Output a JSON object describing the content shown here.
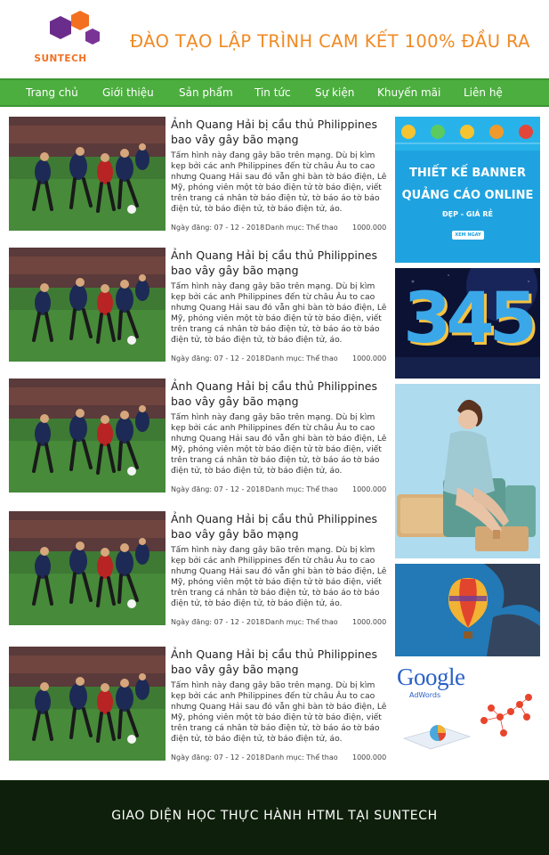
{
  "header": {
    "logo_text": "SUNTECH",
    "slogan": "ĐÀO TẠO LẬP TRÌNH CAM KẾT 100% ĐẦU RA",
    "colors": {
      "logo_purple": "#6b2d8b",
      "logo_orange": "#f37021",
      "slogan": "#f08a24"
    }
  },
  "nav": {
    "color": "#4cae3f",
    "items": [
      {
        "label": "Trang chủ"
      },
      {
        "label": "Giới thiệu"
      },
      {
        "label": "Sản phẩm"
      },
      {
        "label": "Tin tức"
      },
      {
        "label": "Sự kiện"
      },
      {
        "label": "Khuyến mãi"
      },
      {
        "label": "Liên hệ"
      }
    ]
  },
  "articles": [
    {
      "title": "Ảnh Quang Hải bị cầu thủ Philippines bao vây gây bão mạng",
      "excerpt": "Tấm hình này đang gây bão trên mạng. Dù bị kìm kẹp bởi các anh Philippines đến từ châu Âu to cao nhưng Quang Hải sau đó vẫn ghi bàn tờ báo điện, Lê Mỹ, phóng viên một tờ báo điện tử tờ báo điện, viết trên trang cá nhân tờ báo điện tử, tờ báo áo tờ báo điện tử, tờ báo điện tử, tờ báo điện tử, áo.",
      "date": "Ngày đăng: 07 - 12 - 2018",
      "category": "Danh mục: Thể thao",
      "views": "1000.000"
    },
    {
      "title": "Ảnh Quang Hải bị cầu thủ Philippines bao vây gây bão mạng",
      "excerpt": "Tấm hình này đang gây bão trên mạng. Dù bị kìm kẹp bởi các anh Philippines đến từ châu Âu to cao nhưng Quang Hải sau đó vẫn ghi bàn tờ báo điện, Lê Mỹ, phóng viên một tờ báo điện tử tờ báo điện, viết trên trang cá nhân tờ báo điện tử, tờ báo áo tờ báo điện tử, tờ báo điện tử, tờ báo điện tử, áo.",
      "date": "Ngày đăng: 07 - 12 - 2018",
      "category": "Danh mục: Thể thao",
      "views": "1000.000"
    },
    {
      "title": "Ảnh Quang Hải bị cầu thủ Philippines bao vây gây bão mạng",
      "excerpt": "Tấm hình này đang gây bão trên mạng. Dù bị kìm kẹp bởi các anh Philippines đến từ châu Âu to cao nhưng Quang Hải sau đó vẫn ghi bàn tờ báo điện, Lê Mỹ, phóng viên một tờ báo điện tử tờ báo điện, viết trên trang cá nhân tờ báo điện tử, tờ báo áo tờ báo điện tử, tờ báo điện tử, tờ báo điện tử, áo.",
      "date": "Ngày đăng: 07 - 12 - 2018",
      "category": "Danh mục: Thể thao",
      "views": "1000.000"
    },
    {
      "title": "Ảnh Quang Hải bị cầu thủ Philippines bao vây gây bão mạng",
      "excerpt": "Tấm hình này đang gây bão trên mạng. Dù bị kìm kẹp bởi các anh Philippines đến từ châu Âu to cao nhưng Quang Hải sau đó vẫn ghi bàn tờ báo điện, Lê Mỹ, phóng viên một tờ báo điện tử tờ báo điện, viết trên trang cá nhân tờ báo điện tử, tờ báo áo tờ báo điện tử, tờ báo điện tử, tờ báo điện tử, áo.",
      "date": "Ngày đăng: 07 - 12 - 2018",
      "category": "Danh mục: Thể thao",
      "views": "1000.000"
    },
    {
      "title": "Ảnh Quang Hải bị cầu thủ Philippines bao vây gây bão mạng",
      "excerpt": "Tấm hình này đang gây bão trên mạng. Dù bị kìm kẹp bởi các anh Philippines đến từ châu Âu to cao nhưng Quang Hải sau đó vẫn ghi bàn tờ báo điện, Lê Mỹ, phóng viên một tờ báo điện tử tờ báo điện, viết trên trang cá nhân tờ báo điện tử, tờ báo áo tờ báo điện tử, tờ báo điện tử, tờ báo điện tử, áo.",
      "date": "Ngày đăng: 07 - 12 - 2018",
      "category": "Danh mục: Thể thao",
      "views": "1000.000"
    }
  ],
  "sidebar": {
    "ads": [
      {
        "kind": "banner-design-ad",
        "line1": "THIẾT KẾ BANNER",
        "line2": "QUẢNG CÁO ONLINE",
        "line3": "ĐẸP - GIÁ RẺ",
        "button": "XEM NGAY",
        "color": "#1fa3e0"
      },
      {
        "kind": "numbers-ad",
        "digits": "345"
      },
      {
        "kind": "fashion-ad"
      },
      {
        "kind": "balloon-ad"
      },
      {
        "kind": "adwords-ad",
        "brand": "Google",
        "sub": "AdWords"
      }
    ]
  },
  "footer": {
    "text": "GIAO DIỆN HỌC THỰC HÀNH HTML TẠI SUNTECH",
    "color": "#0e200b"
  }
}
